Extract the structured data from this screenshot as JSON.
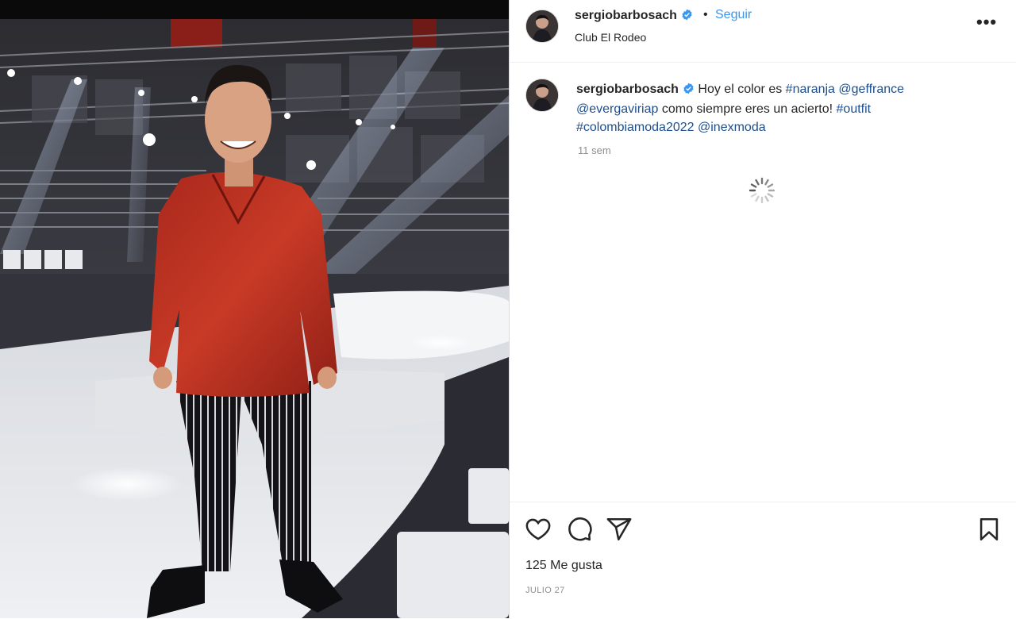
{
  "post": {
    "username": "sergiobarbosach",
    "follow_label": "Seguir",
    "separator": "•",
    "location": "Club El Rodeo",
    "more_label": "•••",
    "caption_text_1": "Hoy el color es",
    "caption_tag_1": "#naranja",
    "caption_mention_1": "@geffrance",
    "caption_mention_2": "@evergaviriap",
    "caption_text_2": "como siempre eres un acierto!",
    "caption_tag_2": "#outfit",
    "caption_tag_3": "#colombiamoda2022",
    "caption_mention_3": "@inexmoda",
    "time_ago": "11 sem",
    "likes": "125 Me gusta",
    "date": "JULIO 27"
  },
  "colors": {
    "link": "#1e4f8c",
    "follow": "#3b96f0",
    "verified": "#3897f0",
    "secondary_text": "#8e8e8e"
  },
  "icons": [
    "verified-badge-icon",
    "more-options-icon",
    "loading-spinner-icon",
    "heart-icon",
    "comment-icon",
    "share-icon",
    "bookmark-icon"
  ]
}
